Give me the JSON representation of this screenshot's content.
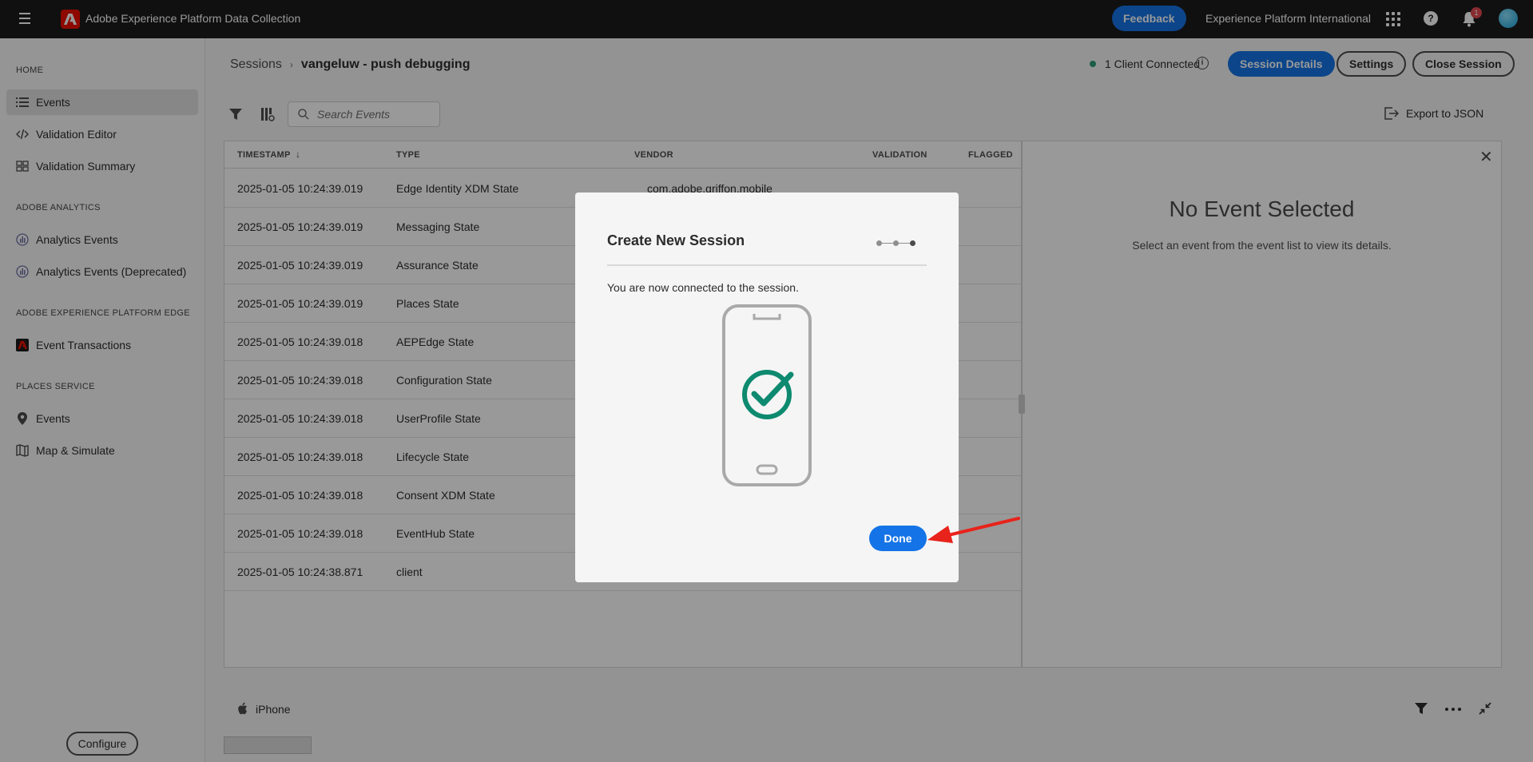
{
  "topbar": {
    "app_title": "Adobe Experience Platform Data Collection",
    "feedback_label": "Feedback",
    "org_name": "Experience Platform International",
    "help_glyph": "?",
    "notification_count": "1"
  },
  "sidebar": {
    "sections": [
      {
        "title": "HOME",
        "items": [
          {
            "label": "Events",
            "icon": "list-icon",
            "active": true
          },
          {
            "label": "Validation Editor",
            "icon": "code-icon"
          },
          {
            "label": "Validation Summary",
            "icon": "summary-icon"
          }
        ]
      },
      {
        "title": "ADOBE ANALYTICS",
        "items": [
          {
            "label": "Analytics Events",
            "icon": "analytics-icon"
          },
          {
            "label": "Analytics Events (Deprecated)",
            "icon": "analytics-icon"
          }
        ]
      },
      {
        "title": "ADOBE EXPERIENCE PLATFORM EDGE",
        "items": [
          {
            "label": "Event Transactions",
            "icon": "adobe-icon"
          }
        ]
      },
      {
        "title": "PLACES SERVICE",
        "items": [
          {
            "label": "Events",
            "icon": "pin-icon"
          },
          {
            "label": "Map & Simulate",
            "icon": "map-icon"
          }
        ]
      }
    ],
    "configure_label": "Configure"
  },
  "header": {
    "breadcrumb_root": "Sessions",
    "breadcrumb_current": "vangeluw - push debugging",
    "status_text": "1 Client Connected",
    "status_color": "#2d9d78",
    "session_details_label": "Session Details",
    "settings_label": "Settings",
    "close_session_label": "Close Session"
  },
  "toolbar": {
    "search_placeholder": "Search Events",
    "export_label": "Export to JSON"
  },
  "table": {
    "columns": [
      "TIMESTAMP",
      "TYPE",
      "VENDOR",
      "VALIDATION",
      "FLAGGED"
    ],
    "rows": [
      {
        "timestamp": "2025-01-05 10:24:39.019",
        "type": "Edge Identity XDM State",
        "vendor": "com.adobe.griffon.mobile"
      },
      {
        "timestamp": "2025-01-05 10:24:39.019",
        "type": "Messaging State",
        "vendor": ""
      },
      {
        "timestamp": "2025-01-05 10:24:39.019",
        "type": "Assurance State",
        "vendor": ""
      },
      {
        "timestamp": "2025-01-05 10:24:39.019",
        "type": "Places State",
        "vendor": ""
      },
      {
        "timestamp": "2025-01-05 10:24:39.018",
        "type": "AEPEdge State",
        "vendor": ""
      },
      {
        "timestamp": "2025-01-05 10:24:39.018",
        "type": "Configuration State",
        "vendor": ""
      },
      {
        "timestamp": "2025-01-05 10:24:39.018",
        "type": "UserProfile State",
        "vendor": ""
      },
      {
        "timestamp": "2025-01-05 10:24:39.018",
        "type": "Lifecycle State",
        "vendor": ""
      },
      {
        "timestamp": "2025-01-05 10:24:39.018",
        "type": "Consent XDM State",
        "vendor": ""
      },
      {
        "timestamp": "2025-01-05 10:24:39.018",
        "type": "EventHub State",
        "vendor": ""
      },
      {
        "timestamp": "2025-01-05 10:24:38.871",
        "type": "client",
        "vendor": ""
      }
    ]
  },
  "detail": {
    "title": "No Event Selected",
    "text": "Select an event from the event list to view its details."
  },
  "footer": {
    "device_name": "iPhone"
  },
  "modal": {
    "title": "Create New Session",
    "steps_total": 3,
    "current_step": 3,
    "message": "You are now connected to the session.",
    "done_label": "Done",
    "check_color": "#0d8a6f",
    "annotation_arrow_color": "#e8231b"
  }
}
